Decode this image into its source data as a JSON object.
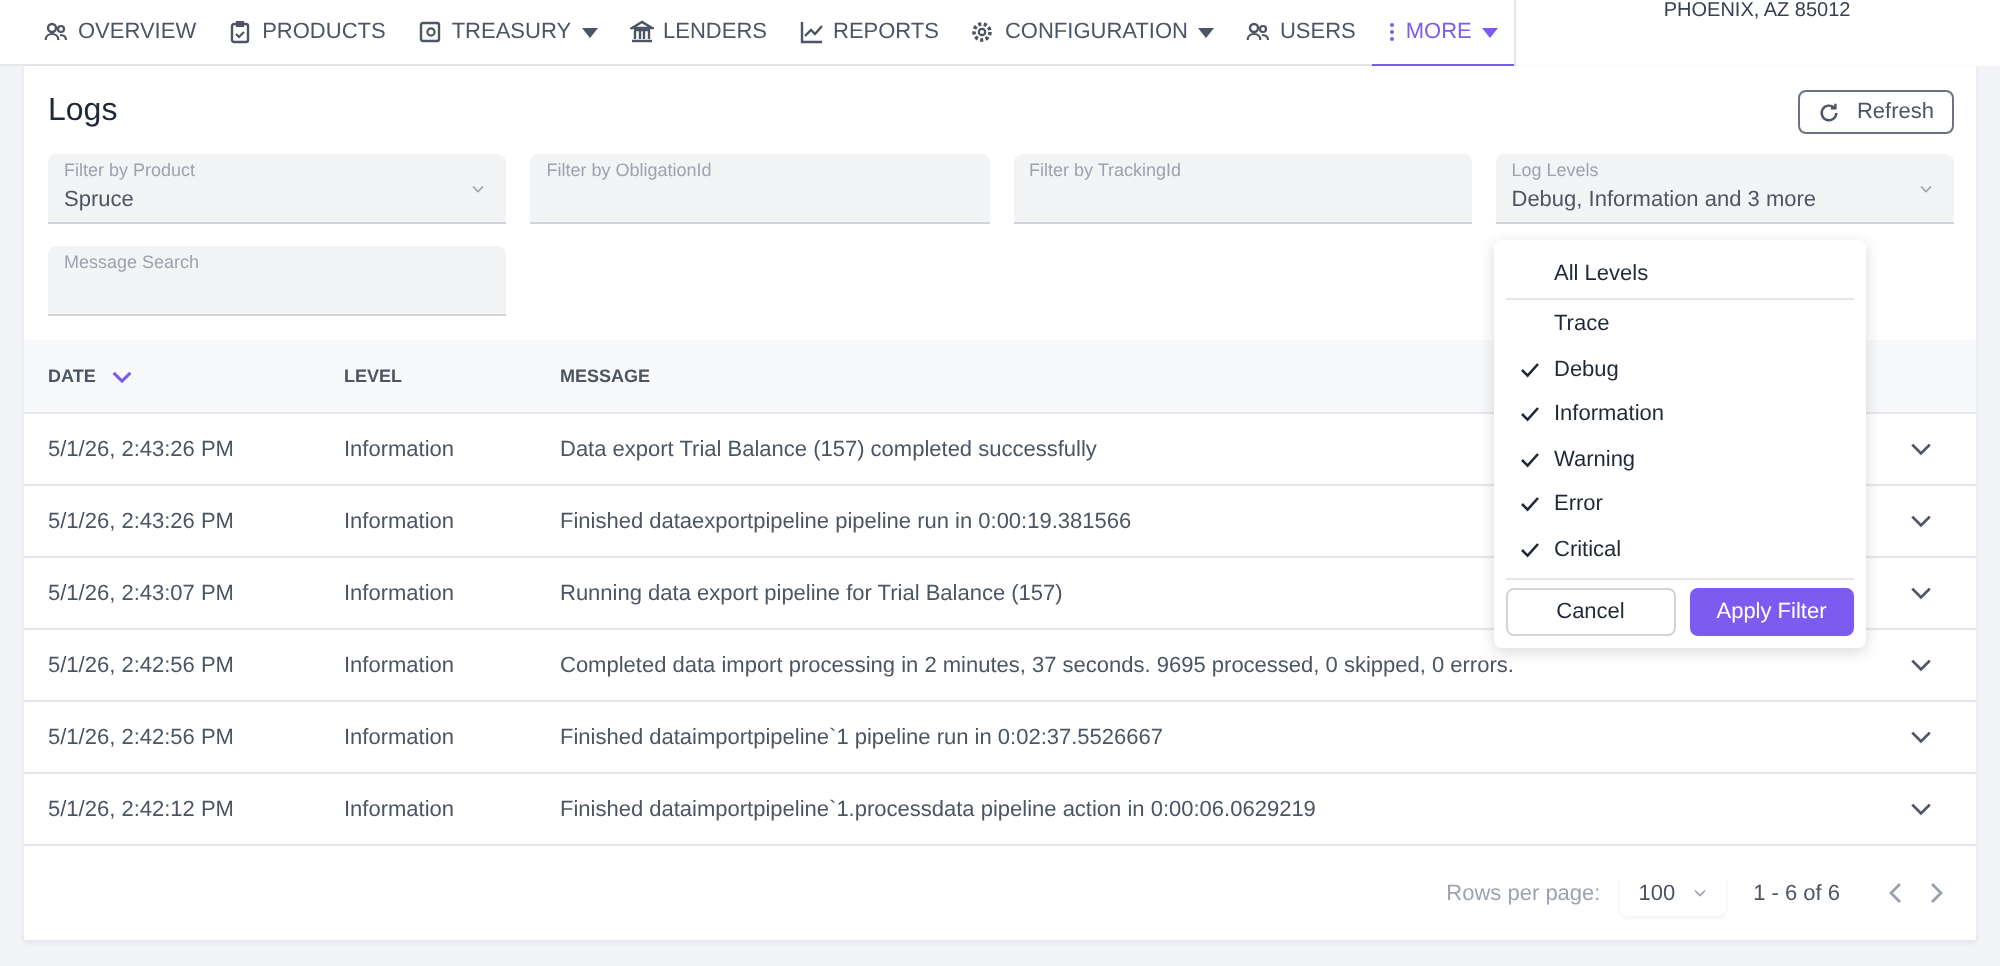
{
  "nav": {
    "items": [
      {
        "label": "OVERVIEW",
        "kind": "people",
        "dropdown": false,
        "selected": false
      },
      {
        "label": "PRODUCTS",
        "kind": "clipboard",
        "dropdown": false,
        "selected": false
      },
      {
        "label": "TREASURY",
        "kind": "safe",
        "dropdown": true,
        "selected": false
      },
      {
        "label": "LENDERS",
        "kind": "bank",
        "dropdown": false,
        "selected": false
      },
      {
        "label": "REPORTS",
        "kind": "chart",
        "dropdown": false,
        "selected": false
      },
      {
        "label": "CONFIGURATION",
        "kind": "gear",
        "dropdown": true,
        "selected": false
      },
      {
        "label": "USERS",
        "kind": "people",
        "dropdown": false,
        "selected": false
      },
      {
        "label": "MORE",
        "kind": "dots",
        "dropdown": true,
        "selected": true
      }
    ],
    "address": "PHOENIX, AZ 85012"
  },
  "page": {
    "title": "Logs",
    "refresh_button": "Refresh"
  },
  "filters": [
    {
      "label": "Filter by Product",
      "value": "Spruce",
      "kind": "select"
    },
    {
      "label": "Filter by ObligationId",
      "kind": "text"
    },
    {
      "label": "Filter by TrackingId",
      "kind": "text"
    },
    {
      "label": "Log Levels",
      "value": "Debug, Information and 3 more",
      "kind": "select"
    },
    {
      "label": "Message Search",
      "kind": "text"
    }
  ],
  "levels_menu": {
    "all_label": "All Levels",
    "options": [
      {
        "label": "Trace",
        "checked": false
      },
      {
        "label": "Debug",
        "checked": true
      },
      {
        "label": "Information",
        "checked": true
      },
      {
        "label": "Warning",
        "checked": true
      },
      {
        "label": "Error",
        "checked": true
      },
      {
        "label": "Critical",
        "checked": true
      }
    ],
    "cancel_button": "Cancel",
    "apply_button": "Apply Filter"
  },
  "table": {
    "columns": [
      "DATE",
      "LEVEL",
      "MESSAGE"
    ],
    "rows": [
      {
        "date": "5/1/26, 2:43:26 PM",
        "level": "Information",
        "message": "Data export Trial Balance (157) completed successfully"
      },
      {
        "date": "5/1/26, 2:43:26 PM",
        "level": "Information",
        "message": "Finished dataexportpipeline pipeline run in 0:00:19.381566"
      },
      {
        "date": "5/1/26, 2:43:07 PM",
        "level": "Information",
        "message": "Running data export pipeline for Trial Balance (157)"
      },
      {
        "date": "5/1/26, 2:42:56 PM",
        "level": "Information",
        "message": "Completed data import processing in 2 minutes, 37 seconds. 9695 processed, 0 skipped, 0 errors."
      },
      {
        "date": "5/1/26, 2:42:56 PM",
        "level": "Information",
        "message": "Finished dataimportpipeline`1 pipeline run in 0:02:37.5526667"
      },
      {
        "date": "5/1/26, 2:42:12 PM",
        "level": "Information",
        "message": "Finished dataimportpipeline`1.processdata pipeline action in 0:00:06.0629219"
      }
    ]
  },
  "pagination": {
    "rows_per_page_label": "Rows per page:",
    "rows_per_page": "100",
    "range": "1 - 6 of 6"
  }
}
